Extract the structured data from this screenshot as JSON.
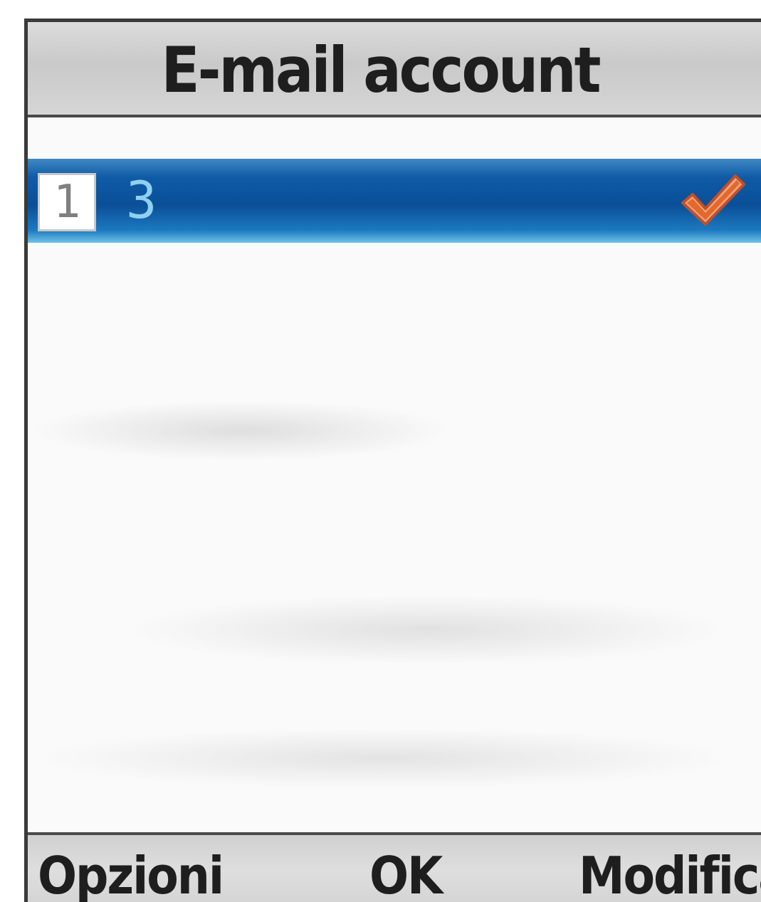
{
  "title_bar": {
    "title": "E-mail account"
  },
  "account_list": {
    "items": [
      {
        "index": "1",
        "label": "3",
        "selected": true,
        "active_icon": "checkmark-icon"
      }
    ]
  },
  "softkeys": {
    "left_label": "Opzioni",
    "center_label": "OK",
    "right_label": "Modifica"
  },
  "colors": {
    "selection": "#0a4f98",
    "checkmark": "#e06a2c",
    "title_bar": "#d0d0d0"
  }
}
